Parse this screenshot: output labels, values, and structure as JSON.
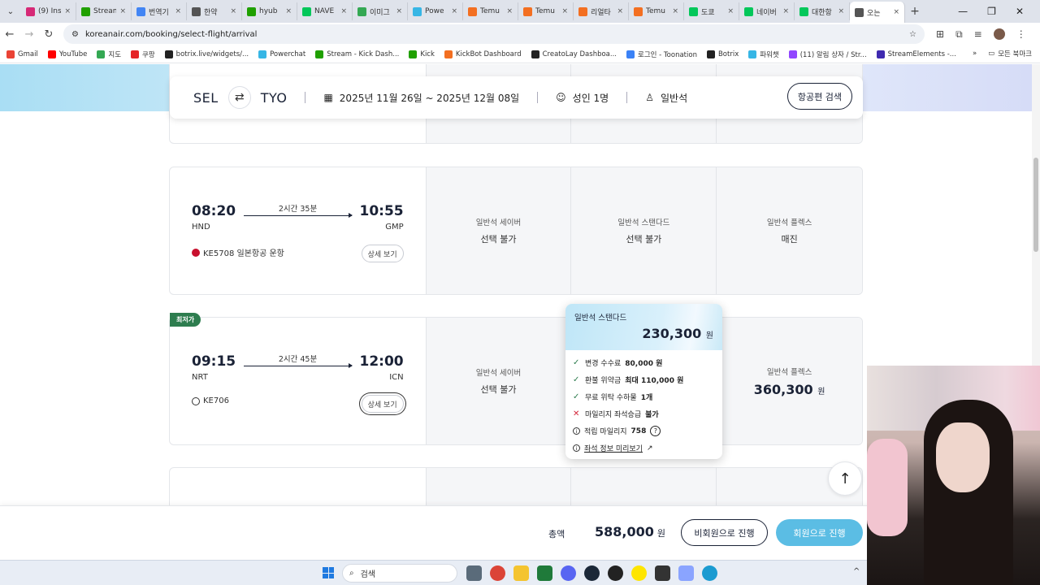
{
  "browser": {
    "tabs": [
      {
        "label": "(9) Ins",
        "color": "#d62976"
      },
      {
        "label": "Stream",
        "color": "#20a000"
      },
      {
        "label": "번역기",
        "color": "#4285f4"
      },
      {
        "label": "한약",
        "color": "#555555"
      },
      {
        "label": "hyub",
        "color": "#20a000"
      },
      {
        "label": "NAVE",
        "color": "#03c75a"
      },
      {
        "label": "이미그",
        "color": "#34a853"
      },
      {
        "label": "Powe",
        "color": "#37b6e5"
      },
      {
        "label": "Temu",
        "color": "#f36f21"
      },
      {
        "label": "Temu",
        "color": "#f36f21"
      },
      {
        "label": "리얼타",
        "color": "#f36f21"
      },
      {
        "label": "Temu",
        "color": "#f36f21"
      },
      {
        "label": "도쿄",
        "color": "#03c75a"
      },
      {
        "label": "네이버",
        "color": "#03c75a"
      },
      {
        "label": "대한항",
        "color": "#03c75a"
      },
      {
        "label": "오는",
        "color": "#555555"
      }
    ],
    "url": "koreanair.com/booking/select-flight/arrival",
    "bookmarks": [
      {
        "label": "Gmail",
        "color": "#ea4335"
      },
      {
        "label": "YouTube",
        "color": "#ff0000"
      },
      {
        "label": "지도",
        "color": "#34a853"
      },
      {
        "label": "쿠팡",
        "color": "#e52528"
      },
      {
        "label": "botrix.live/widgets/...",
        "color": "#222222"
      },
      {
        "label": "Powerchat",
        "color": "#37b6e5"
      },
      {
        "label": "Stream - Kick Dash...",
        "color": "#20a000"
      },
      {
        "label": "Kick",
        "color": "#20a000"
      },
      {
        "label": "KickBot Dashboard",
        "color": "#f36f21"
      },
      {
        "label": "CreatoLay Dashboa...",
        "color": "#222222"
      },
      {
        "label": "로그인 - Toonation",
        "color": "#3b82f6"
      },
      {
        "label": "Botrix",
        "color": "#222222"
      },
      {
        "label": "파워챗",
        "color": "#37b6e5"
      },
      {
        "label": "(11) 알림 상자 / Str...",
        "color": "#9146ff"
      },
      {
        "label": "StreamElements -...",
        "color": "#3f2ab0"
      }
    ],
    "all_bookmarks": "모든 북마크"
  },
  "search": {
    "origin": "SEL",
    "destination": "TYO",
    "dates": "2025년 11월 26일 ~ 2025년 12월 08일",
    "passengers": "성인 1명",
    "cabin": "일반석",
    "search_label": "항공편 검색"
  },
  "flights": [
    {
      "dep_time": "08:20",
      "dep_code": "HND",
      "duration": "2시간 35분",
      "arr_time": "10:55",
      "arr_code": "GMP",
      "flight_no": "KE5708 일본항공 운항",
      "detail_label": "상세 보기",
      "fares": [
        {
          "name": "일반석 세이버",
          "status": "선택 불가"
        },
        {
          "name": "일반석 스탠다드",
          "status": "선택 불가"
        },
        {
          "name": "일반석 플렉스",
          "status": "매진"
        }
      ]
    },
    {
      "badge": "최저가",
      "dep_time": "09:15",
      "dep_code": "NRT",
      "duration": "2시간 45분",
      "arr_time": "12:00",
      "arr_code": "ICN",
      "flight_no": "KE706",
      "detail_label": "상세 보기",
      "fares": [
        {
          "name": "일반석 세이버",
          "status": "선택 불가"
        },
        {
          "name": "일반석 플렉스",
          "price": "360,300",
          "won": "원"
        }
      ]
    }
  ],
  "popover": {
    "title": "일반석 스탠다드",
    "price": "230,300",
    "won": "원",
    "rows": [
      {
        "label": "변경 수수료",
        "value": "80,000 원"
      },
      {
        "label": "환불 위약금",
        "value": "최대 110,000 원"
      },
      {
        "label": "무료 위탁 수하물",
        "value": "1개"
      },
      {
        "label": "마일리지 좌석승급",
        "value": "불가"
      },
      {
        "label": "적립 마일리지",
        "value": "758"
      }
    ],
    "seat_preview": "좌석 정보 미리보기"
  },
  "total": {
    "label": "총액",
    "amount": "588,000",
    "won": "원",
    "guest_label": "비회원으로 진행",
    "member_label": "회원으로 진행"
  },
  "taskbar": {
    "search_placeholder": "검색"
  }
}
